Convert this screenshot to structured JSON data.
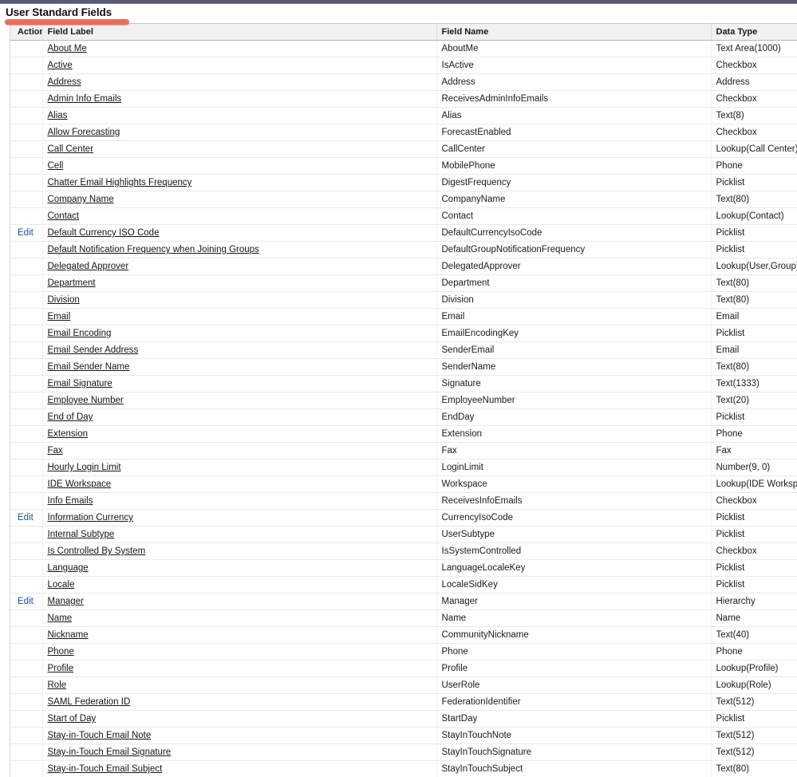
{
  "page": {
    "title": "User Standard Fields",
    "accent_color": "#ef6c5a",
    "top_bar_color": "#565a76",
    "link_color": "#1e4fa3"
  },
  "table": {
    "columns": [
      {
        "key": "action",
        "label": "Action"
      },
      {
        "key": "field_label",
        "label": "Field Label"
      },
      {
        "key": "field_name",
        "label": "Field Name"
      },
      {
        "key": "data_type",
        "label": "Data Type"
      }
    ],
    "edit_label": "Edit",
    "rows": [
      {
        "action": "",
        "field_label": "About Me",
        "field_name": "AboutMe",
        "data_type": "Text Area(1000)"
      },
      {
        "action": "",
        "field_label": "Active",
        "field_name": "IsActive",
        "data_type": "Checkbox"
      },
      {
        "action": "",
        "field_label": "Address",
        "field_name": "Address",
        "data_type": "Address"
      },
      {
        "action": "",
        "field_label": "Admin Info Emails",
        "field_name": "ReceivesAdminInfoEmails",
        "data_type": "Checkbox"
      },
      {
        "action": "",
        "field_label": "Alias",
        "field_name": "Alias",
        "data_type": "Text(8)"
      },
      {
        "action": "",
        "field_label": "Allow Forecasting",
        "field_name": "ForecastEnabled",
        "data_type": "Checkbox"
      },
      {
        "action": "",
        "field_label": "Call Center",
        "field_name": "CallCenter",
        "data_type": "Lookup(Call Center)"
      },
      {
        "action": "",
        "field_label": "Cell",
        "field_name": "MobilePhone",
        "data_type": "Phone"
      },
      {
        "action": "",
        "field_label": "Chatter Email Highlights Frequency",
        "field_name": "DigestFrequency",
        "data_type": "Picklist"
      },
      {
        "action": "",
        "field_label": "Company Name",
        "field_name": "CompanyName",
        "data_type": "Text(80)"
      },
      {
        "action": "",
        "field_label": "Contact",
        "field_name": "Contact",
        "data_type": "Lookup(Contact)"
      },
      {
        "action": "Edit",
        "field_label": "Default Currency ISO Code",
        "field_name": "DefaultCurrencyIsoCode",
        "data_type": "Picklist"
      },
      {
        "action": "",
        "field_label": "Default Notification Frequency when Joining Groups",
        "field_name": "DefaultGroupNotificationFrequency",
        "data_type": "Picklist"
      },
      {
        "action": "",
        "field_label": "Delegated Approver",
        "field_name": "DelegatedApprover",
        "data_type": "Lookup(User,Group)"
      },
      {
        "action": "",
        "field_label": "Department",
        "field_name": "Department",
        "data_type": "Text(80)"
      },
      {
        "action": "",
        "field_label": "Division",
        "field_name": "Division",
        "data_type": "Text(80)"
      },
      {
        "action": "",
        "field_label": "Email",
        "field_name": "Email",
        "data_type": "Email"
      },
      {
        "action": "",
        "field_label": "Email Encoding",
        "field_name": "EmailEncodingKey",
        "data_type": "Picklist"
      },
      {
        "action": "",
        "field_label": "Email Sender Address",
        "field_name": "SenderEmail",
        "data_type": "Email"
      },
      {
        "action": "",
        "field_label": "Email Sender Name",
        "field_name": "SenderName",
        "data_type": "Text(80)"
      },
      {
        "action": "",
        "field_label": "Email Signature",
        "field_name": "Signature",
        "data_type": "Text(1333)"
      },
      {
        "action": "",
        "field_label": "Employee Number",
        "field_name": "EmployeeNumber",
        "data_type": "Text(20)"
      },
      {
        "action": "",
        "field_label": "End of Day",
        "field_name": "EndDay",
        "data_type": "Picklist"
      },
      {
        "action": "",
        "field_label": "Extension",
        "field_name": "Extension",
        "data_type": "Phone"
      },
      {
        "action": "",
        "field_label": "Fax",
        "field_name": "Fax",
        "data_type": "Fax"
      },
      {
        "action": "",
        "field_label": "Hourly Login Limit",
        "field_name": "LoginLimit",
        "data_type": "Number(9, 0)"
      },
      {
        "action": "",
        "field_label": "IDE Workspace",
        "field_name": "Workspace",
        "data_type": "Lookup(IDE Workspace)"
      },
      {
        "action": "",
        "field_label": "Info Emails",
        "field_name": "ReceivesInfoEmails",
        "data_type": "Checkbox"
      },
      {
        "action": "Edit",
        "field_label": "Information Currency",
        "field_name": "CurrencyIsoCode",
        "data_type": "Picklist"
      },
      {
        "action": "",
        "field_label": "Internal Subtype",
        "field_name": "UserSubtype",
        "data_type": "Picklist"
      },
      {
        "action": "",
        "field_label": "Is Controlled By System",
        "field_name": "IsSystemControlled",
        "data_type": "Checkbox"
      },
      {
        "action": "",
        "field_label": "Language",
        "field_name": "LanguageLocaleKey",
        "data_type": "Picklist"
      },
      {
        "action": "",
        "field_label": "Locale",
        "field_name": "LocaleSidKey",
        "data_type": "Picklist"
      },
      {
        "action": "Edit",
        "field_label": "Manager",
        "field_name": "Manager",
        "data_type": "Hierarchy"
      },
      {
        "action": "",
        "field_label": "Name",
        "field_name": "Name",
        "data_type": "Name"
      },
      {
        "action": "",
        "field_label": "Nickname",
        "field_name": "CommunityNickname",
        "data_type": "Text(40)"
      },
      {
        "action": "",
        "field_label": "Phone",
        "field_name": "Phone",
        "data_type": "Phone"
      },
      {
        "action": "",
        "field_label": "Profile",
        "field_name": "Profile",
        "data_type": "Lookup(Profile)"
      },
      {
        "action": "",
        "field_label": "Role",
        "field_name": "UserRole",
        "data_type": "Lookup(Role)"
      },
      {
        "action": "",
        "field_label": "SAML Federation ID",
        "field_name": "FederationIdentifier",
        "data_type": "Text(512)"
      },
      {
        "action": "",
        "field_label": "Start of Day",
        "field_name": "StartDay",
        "data_type": "Picklist"
      },
      {
        "action": "",
        "field_label": "Stay-in-Touch Email Note",
        "field_name": "StayInTouchNote",
        "data_type": "Text(512)"
      },
      {
        "action": "",
        "field_label": "Stay-in-Touch Email Signature",
        "field_name": "StayInTouchSignature",
        "data_type": "Text(512)"
      },
      {
        "action": "",
        "field_label": "Stay-in-Touch Email Subject",
        "field_name": "StayInTouchSubject",
        "data_type": "Text(80)"
      }
    ]
  }
}
